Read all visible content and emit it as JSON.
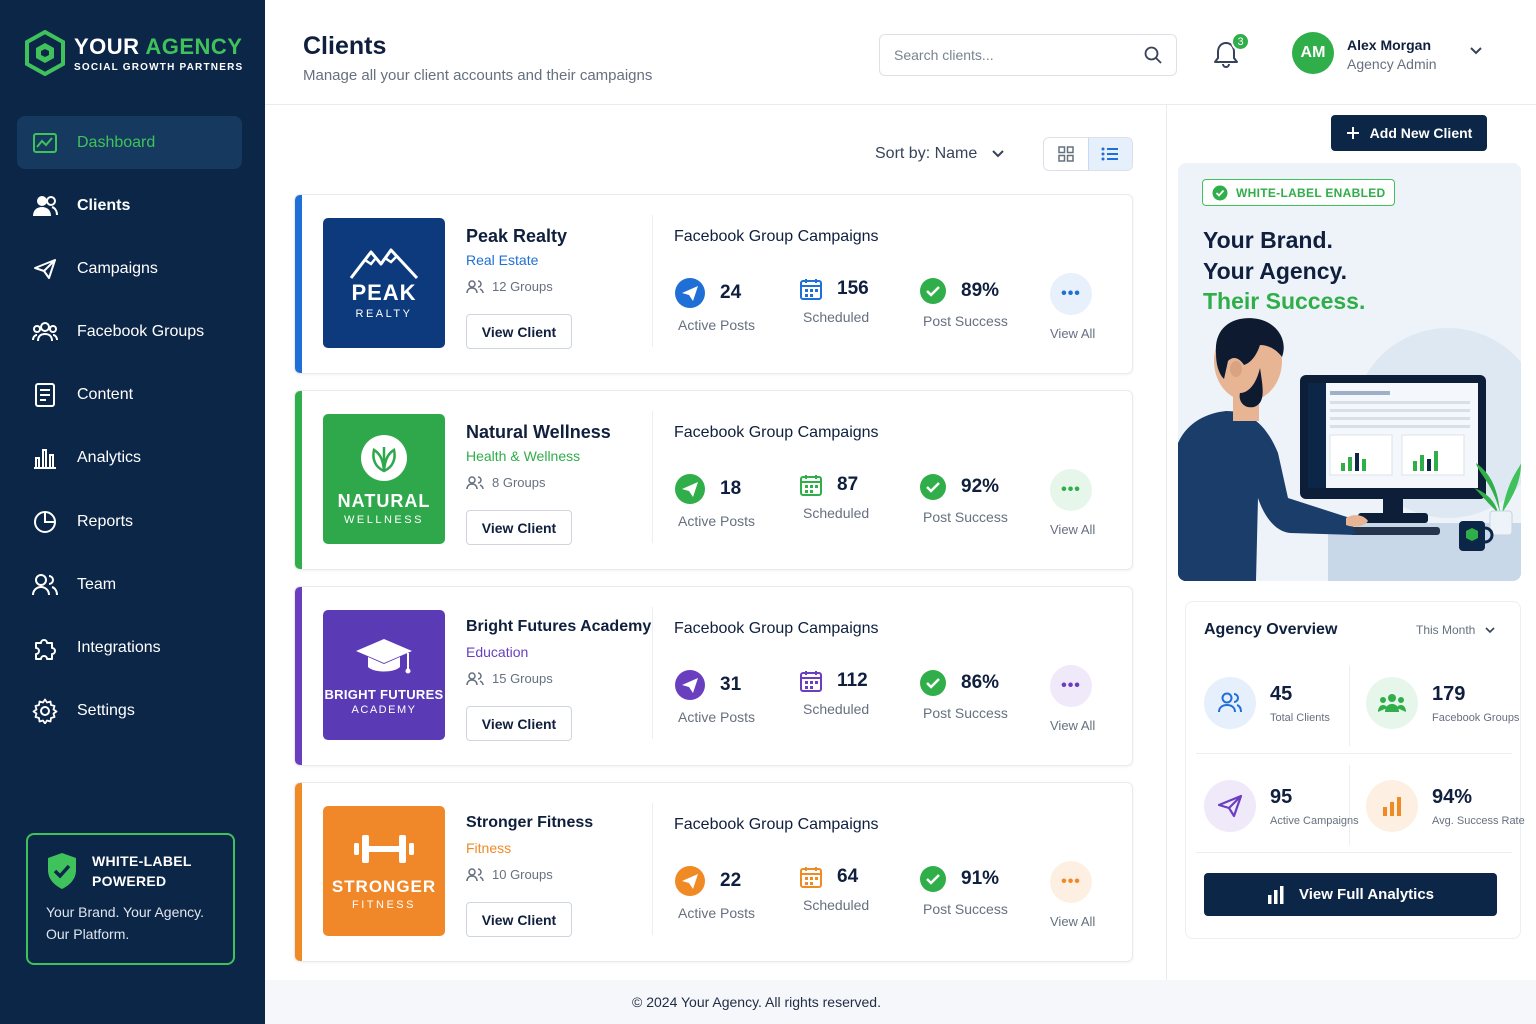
{
  "brand": {
    "name_part1": "YOUR",
    "name_part2": "AGENCY",
    "tagline": "SOCIAL GROWTH PARTNERS"
  },
  "sidebar": {
    "items": [
      {
        "label": "Dashboard",
        "icon": "dashboard-icon",
        "active": true
      },
      {
        "label": "Clients",
        "icon": "users-icon"
      },
      {
        "label": "Campaigns",
        "icon": "paper-plane-icon"
      },
      {
        "label": "Facebook Groups",
        "icon": "groups-icon"
      },
      {
        "label": "Content",
        "icon": "document-icon"
      },
      {
        "label": "Analytics",
        "icon": "bar-chart-icon"
      },
      {
        "label": "Reports",
        "icon": "pie-chart-icon"
      },
      {
        "label": "Team",
        "icon": "team-icon"
      },
      {
        "label": "Integrations",
        "icon": "puzzle-icon"
      },
      {
        "label": "Settings",
        "icon": "gear-icon"
      }
    ],
    "white_label": {
      "title_line1": "WHITE-LABEL",
      "title_line2": "POWERED",
      "line1": "Your Brand. Your Agency.",
      "line2": "Our Platform."
    }
  },
  "header": {
    "title": "Clients",
    "subtitle": "Manage all your client accounts and their campaigns",
    "search_placeholder": "Search clients...",
    "notifications": "3",
    "user": {
      "initials": "AM",
      "name": "Alex Morgan",
      "role": "Agency Admin"
    }
  },
  "toolbar": {
    "sort_label": "Sort by: Name"
  },
  "clients": [
    {
      "name": "Peak Realty",
      "category": "Real Estate",
      "groups": "12 Groups",
      "view": "View Client",
      "campaign_title": "Facebook Group Campaigns",
      "tile_big": "PEAK",
      "tile_small": "REALTY",
      "active_posts": "24",
      "active_label": "Active Posts",
      "scheduled": "156",
      "scheduled_label": "Scheduled",
      "success": "89%",
      "success_label": "Post Success",
      "view_all": "View All",
      "accent": "#1f6fd6",
      "tile_color": "#0d3a7c"
    },
    {
      "name": "Natural Wellness",
      "category": "Health & Wellness",
      "groups": "8 Groups",
      "view": "View Client",
      "campaign_title": "Facebook Group Campaigns",
      "tile_big": "NATURAL",
      "tile_small": "WELLNESS",
      "active_posts": "18",
      "active_label": "Active Posts",
      "scheduled": "87",
      "scheduled_label": "Scheduled",
      "success": "92%",
      "success_label": "Post Success",
      "view_all": "View All",
      "accent": "#2fae49",
      "tile_color": "#2fa84c"
    },
    {
      "name": "Bright Futures Academy",
      "category": "Education",
      "groups": "15 Groups",
      "view": "View Client",
      "campaign_title": "Facebook Group Campaigns",
      "tile_big": "BRIGHT FUTURES",
      "tile_small": "ACADEMY",
      "active_posts": "31",
      "active_label": "Active Posts",
      "scheduled": "112",
      "scheduled_label": "Scheduled",
      "success": "86%",
      "success_label": "Post Success",
      "view_all": "View All",
      "accent": "#6a3fbf",
      "tile_color": "#5b3bb5"
    },
    {
      "name": "Stronger Fitness",
      "category": "Fitness",
      "groups": "10 Groups",
      "view": "View Client",
      "campaign_title": "Facebook Group Campaigns",
      "tile_big": "STRONGER",
      "tile_small": "FITNESS",
      "active_posts": "22",
      "active_label": "Active Posts",
      "scheduled": "64",
      "scheduled_label": "Scheduled",
      "success": "91%",
      "success_label": "Post Success",
      "view_all": "View All",
      "accent": "#f08a24",
      "tile_color": "#f0882a"
    }
  ],
  "right_panel": {
    "add_button": "Add New Client",
    "promo": {
      "tag": "WHITE-LABEL ENABLED",
      "line1": "Your Brand.",
      "line2": "Your Agency.",
      "line3": "Their Success."
    },
    "overview": {
      "title": "Agency Overview",
      "period": "This Month",
      "stats": [
        {
          "value": "45",
          "label": "Total Clients"
        },
        {
          "value": "179",
          "label": "Facebook Groups"
        },
        {
          "value": "95",
          "label": "Active Campaigns"
        },
        {
          "value": "94%",
          "label": "Avg. Success Rate"
        }
      ],
      "button": "View Full Analytics"
    }
  },
  "footer": {
    "copyright": "© 2024 Your Agency. All rights reserved."
  }
}
